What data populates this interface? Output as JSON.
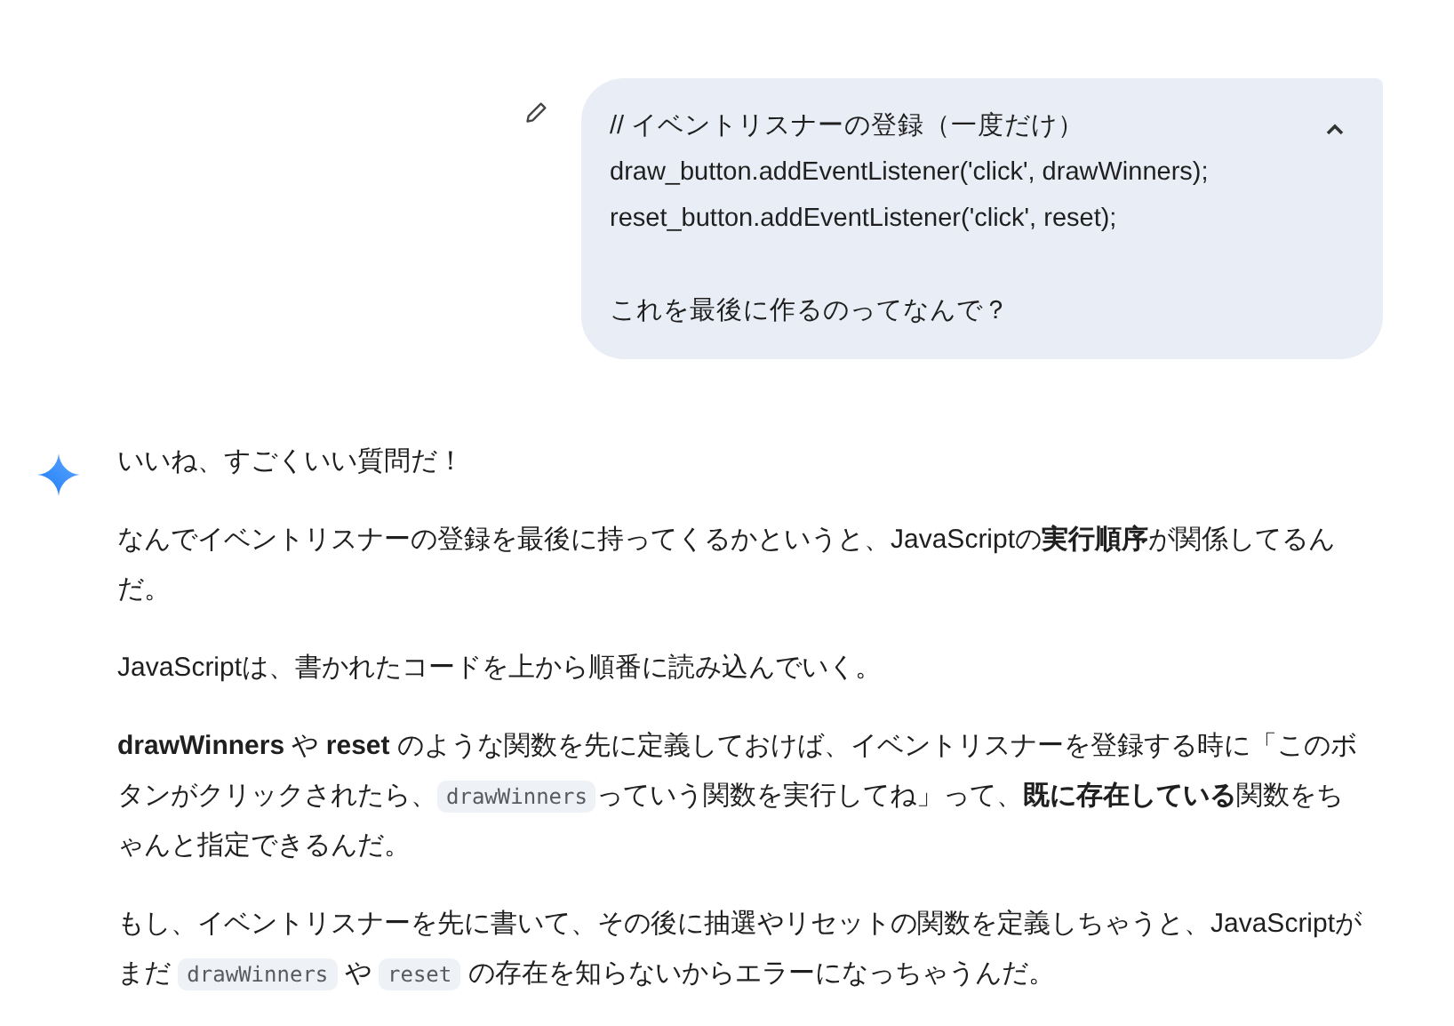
{
  "user_message": {
    "expanded": true,
    "blocks": [
      {
        "lines": [
          "// イベントリスナーの登録（一度だけ）",
          "draw_button.addEventListener('click', drawWinners);",
          "reset_button.addEventListener('click', reset);"
        ]
      },
      {
        "lines": [
          "これを最後に作るのってなんで？"
        ]
      }
    ]
  },
  "response": {
    "paragraphs": [
      [
        {
          "kind": "text",
          "text": "いいね、すごくいい質問だ！"
        }
      ],
      [
        {
          "kind": "text",
          "text": "なんでイベントリスナーの登録を最後に持ってくるかというと、JavaScriptの**実行順序**が関係してるんだ。"
        }
      ],
      [
        {
          "kind": "text",
          "text": "JavaScriptは、書かれたコードを上から順番に読み込んでいく。"
        }
      ],
      [
        {
          "kind": "text",
          "text": "**drawWinners** や **reset** のような関数を先に定義しておけば、イベントリスナーを登録する時に「このボタンがクリックされたら、"
        },
        {
          "kind": "code",
          "text": "drawWinners"
        },
        {
          "kind": "text",
          "text": "っていう関数を実行してね」って、**既に存在している**関数をちゃんと指定できるんだ。"
        }
      ],
      [
        {
          "kind": "text",
          "text": "もし、イベントリスナーを先に書いて、その後に抽選やリセットの関数を定義しちゃうと、JavaScriptがまだ "
        },
        {
          "kind": "code",
          "text": "drawWinners"
        },
        {
          "kind": "text",
          "text": " や "
        },
        {
          "kind": "code",
          "text": "reset"
        },
        {
          "kind": "text",
          "text": " の存在を知らないからエラーになっちゃうんだ。"
        }
      ]
    ]
  }
}
